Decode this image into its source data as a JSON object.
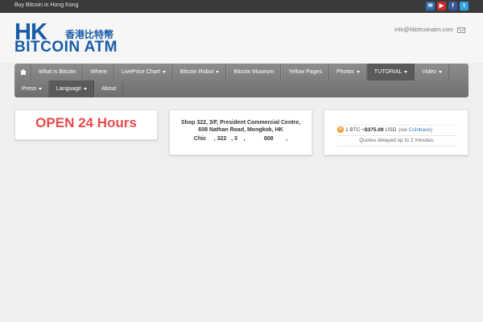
{
  "topbar": {
    "tagline": "Buy Bitcoin in Hong Kong",
    "social": [
      {
        "icon": "mail-icon",
        "glyph": "✉"
      },
      {
        "icon": "youtube-icon",
        "glyph": "▶"
      },
      {
        "icon": "facebook-icon",
        "glyph": "f"
      },
      {
        "icon": "twitter-icon",
        "glyph": "t"
      }
    ]
  },
  "header": {
    "logo_hk": "HK",
    "logo_cn": "香港比特幣",
    "logo_name": "BITCOIN ATM",
    "email": "info@hkbitcoinatm.com"
  },
  "nav": {
    "row1": [
      {
        "label": "What is Bitcoin",
        "dropdown": false
      },
      {
        "label": "Where",
        "dropdown": false
      },
      {
        "label": "LivePrice Chart",
        "dropdown": true
      },
      {
        "label": "Bitcoin Robot",
        "dropdown": true
      },
      {
        "label": "Bitcoin Museum",
        "dropdown": false
      },
      {
        "label": "Yellow Pages",
        "dropdown": false
      },
      {
        "label": "Photos",
        "dropdown": true
      },
      {
        "label": "TUTORIAL",
        "dropdown": true
      },
      {
        "label": "Video",
        "dropdown": true
      }
    ],
    "row2": [
      {
        "label": "Press",
        "dropdown": true
      },
      {
        "label": "Language",
        "dropdown": true
      },
      {
        "label": "About",
        "dropdown": false
      }
    ]
  },
  "panels": {
    "hours": "OPEN 24 Hours",
    "address_line1": "Shop 322, 3/F, President Commercial Centre,",
    "address_line2": "608 Nathan Road, Mongkok, HK",
    "address_cn": "Chic     , 322   , 3    ,            608        ,",
    "price": {
      "prefix": "1 BTC =",
      "amount": "$375.09",
      "currency": "USD",
      "via_prefix": "(via",
      "via_link": "Coinbase",
      "via_suffix": ")",
      "note": "Quotes delayed up to 2 minutes."
    }
  },
  "colors": {
    "brand_blue": "#1a5ca8",
    "open_red": "#e84a4a",
    "bitcoin_orange": "#f7931a"
  }
}
